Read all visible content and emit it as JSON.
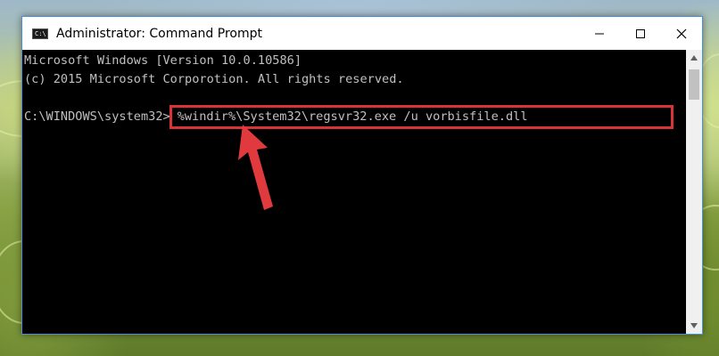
{
  "window": {
    "title": "Administrator: Command Prompt",
    "icon_label": "C:\\",
    "border_color": "#4a90d9"
  },
  "controls": {
    "minimize_icon": "minimize-icon",
    "maximize_icon": "maximize-icon",
    "close_icon": "close-icon"
  },
  "console": {
    "lines": [
      "Microsoft Windows [Version 10.0.10586]",
      "(c) 2015 Microsoft Corporotion. All rights reserved."
    ],
    "prompt": "C:\\WINDOWS\\system32>",
    "command": "%windir%\\System32\\regsvr32.exe /u vorbisfile.dll",
    "text_color": "#c0c0c0",
    "background": "#000000"
  },
  "annotation": {
    "highlight_color": "#d9333a",
    "arrow_icon": "red-arrow-icon"
  }
}
